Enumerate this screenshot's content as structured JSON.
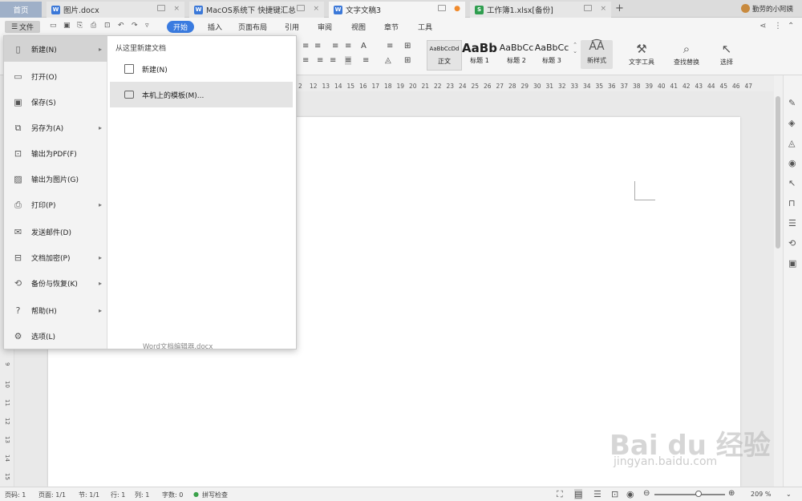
{
  "tabs": [
    {
      "label": "首页",
      "color": "#8a9bb5",
      "icon": ""
    },
    {
      "label": "图片.docx",
      "color": "#3b78d8",
      "icon": "W"
    },
    {
      "label": "MacOS系统下 快捷键汇总",
      "color": "#3b78d8",
      "icon": "W"
    },
    {
      "label": "文字文稿3",
      "color": "#3b78d8",
      "icon": "W"
    },
    {
      "label": "工作簿1.xlsx[备份]",
      "color": "#2f9e4f",
      "icon": "S"
    }
  ],
  "user": "勤劳的小阿姨",
  "new_tab": "+",
  "toolbar": {
    "file_label": "文件",
    "ribbon_tabs": [
      "开始",
      "插入",
      "页面布局",
      "引用",
      "审阅",
      "视图",
      "章节",
      "工具"
    ],
    "styles": [
      {
        "preview": "AaBbCcDd",
        "name": "正文"
      },
      {
        "preview": "AaBb",
        "name": "标题 1"
      },
      {
        "preview": "AaBbCc",
        "name": "标题 2"
      },
      {
        "preview": "AaBbCc",
        "name": "标题 3"
      }
    ],
    "new_style": "新样式",
    "text_tools": "文字工具",
    "find_replace": "查找替换",
    "select": "选择"
  },
  "ruler_numbers": [
    "2",
    "12",
    "13",
    "14",
    "15",
    "16",
    "17",
    "18",
    "19",
    "20",
    "21",
    "22",
    "23",
    "24",
    "25",
    "26",
    "27",
    "28",
    "29",
    "30",
    "31",
    "32",
    "33",
    "34",
    "35",
    "36",
    "37",
    "38",
    "39",
    "40",
    "41",
    "42",
    "43",
    "44",
    "45",
    "46",
    "47"
  ],
  "vruler_numbers": [
    "9",
    "10",
    "11",
    "12",
    "13",
    "14",
    "15"
  ],
  "file_menu": {
    "items": [
      {
        "label": "新建(N)",
        "icon": "new-doc-icon",
        "glyph": "▯",
        "arrow": true
      },
      {
        "label": "打开(O)",
        "icon": "folder-icon",
        "glyph": "▭",
        "arrow": false
      },
      {
        "label": "保存(S)",
        "icon": "save-icon",
        "glyph": "▣",
        "arrow": false
      },
      {
        "label": "另存为(A)",
        "icon": "save-as-icon",
        "glyph": "⧉",
        "arrow": true
      },
      {
        "label": "输出为PDF(F)",
        "icon": "pdf-icon",
        "glyph": "⊡",
        "arrow": false
      },
      {
        "label": "输出为图片(G)",
        "icon": "image-icon",
        "glyph": "▨",
        "arrow": false
      },
      {
        "label": "打印(P)",
        "icon": "print-icon",
        "glyph": "⎙",
        "arrow": true
      },
      {
        "label": "发送邮件(D)",
        "icon": "mail-icon",
        "glyph": "✉",
        "arrow": false
      },
      {
        "label": "文档加密(P)",
        "icon": "lock-icon",
        "glyph": "⊟",
        "arrow": true
      },
      {
        "label": "备份与恢复(K)",
        "icon": "backup-icon",
        "glyph": "⟲",
        "arrow": true
      },
      {
        "label": "帮助(H)",
        "icon": "help-icon",
        "glyph": "?",
        "arrow": true
      },
      {
        "label": "选项(L)",
        "icon": "gear-icon",
        "glyph": "⚙",
        "arrow": false
      }
    ],
    "submenu_title": "从这里新建文档",
    "submenu_items": [
      {
        "label": "新建(N)"
      },
      {
        "label": "本机上的模板(M)..."
      }
    ],
    "recent_file": "Word文档编辑器.docx"
  },
  "status": {
    "page_no": "页码: 1",
    "pages": "页面: 1/1",
    "section": "节: 1/1",
    "row": "行: 1",
    "col": "列: 1",
    "words": "字数: 0",
    "spell": "拼写检查",
    "zoom": "209 %"
  },
  "watermark": {
    "brand": "Bai du 经验",
    "url": "jingyan.baidu.com"
  }
}
